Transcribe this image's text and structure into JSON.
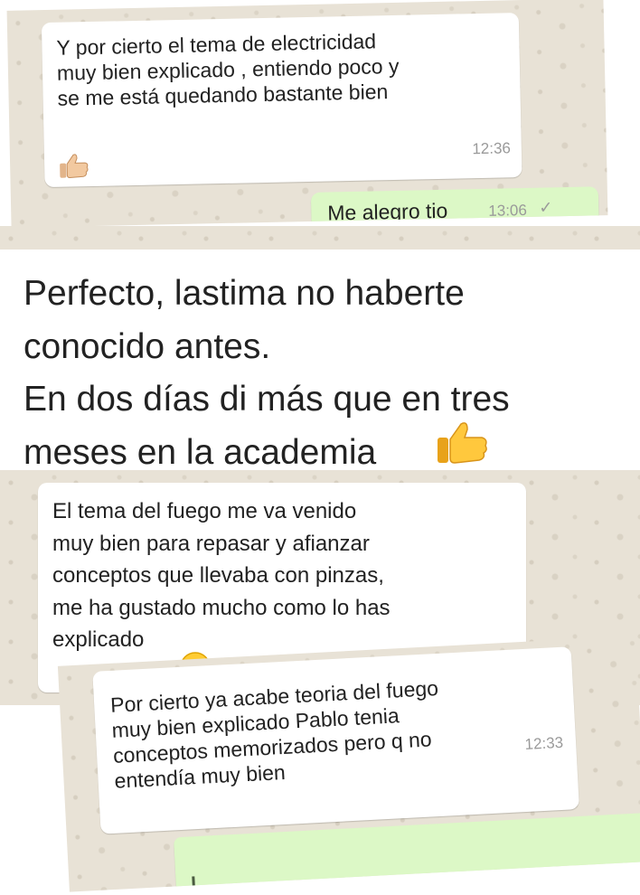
{
  "screenshots": [
    {
      "messages": [
        {
          "text": "Y por cierto el tema de electricidad\nmuy bien explicado , entiendo poco y\nse me está quedando bastante bien",
          "emoji": "thumbs-up-icon",
          "time": "12:36"
        },
        {
          "text": "Me alegro tio",
          "time": "13:06",
          "status": "✓"
        }
      ]
    },
    {
      "messages": [
        {
          "text": "Perfecto, lastima no haberte\nconocido antes.\nEn dos días di más que en tres\nmeses en la academia",
          "emoji": "thumbs-up-icon"
        }
      ]
    },
    {
      "messages": [
        {
          "text": "El tema del fuego me va venido\nmuy bien para repasar y afianzar\nconceptos que llevaba con pinzas,\nme ha gustado mucho como lo has\nexplicado",
          "emoji": "grinning-face-icon"
        }
      ]
    },
    {
      "messages": [
        {
          "text": "Por cierto ya acabe teoria del fuego\nmuy bien explicado Pablo tenia\nconceptos memorizados pero q no\nentendía muy bien",
          "time": "12:33"
        }
      ]
    }
  ],
  "colors": {
    "chat_background": "#e8e2d6",
    "incoming_bubble": "#ffffff",
    "outgoing_bubble": "#dcf8c6",
    "timestamp": "#9a9a9a"
  }
}
